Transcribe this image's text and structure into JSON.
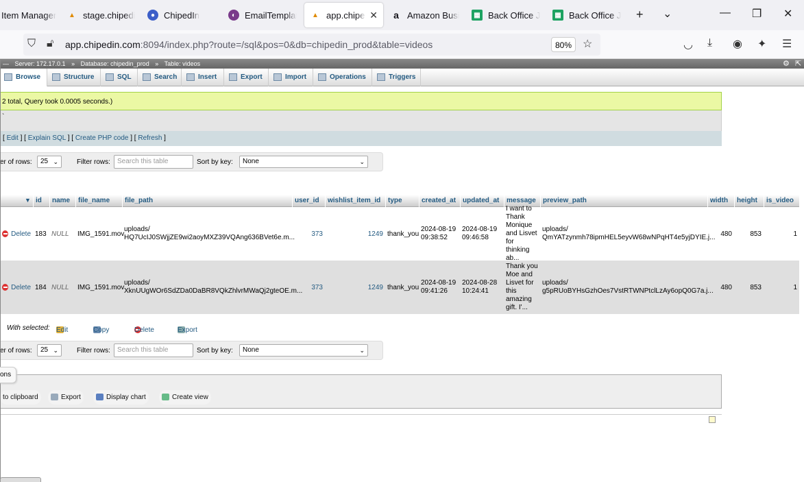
{
  "browser": {
    "tabs": [
      {
        "title": "Item Manager",
        "icon": "page-icon"
      },
      {
        "title": "stage.chipedin",
        "icon": "pma-icon"
      },
      {
        "title": "ChipedIn",
        "icon": "chipedin-icon"
      },
      {
        "title": "EmailTemplate",
        "icon": "email-icon"
      },
      {
        "title": "app.chipedi",
        "icon": "pma-icon",
        "active": true
      },
      {
        "title": "Amazon Busine",
        "icon": "amazon-icon"
      },
      {
        "title": "Back Office Ju",
        "icon": "sheets-icon"
      },
      {
        "title": "Back Office Ju",
        "icon": "sheets-icon"
      }
    ],
    "url_host": "app.chipedin.com",
    "url_rest": ":8094/index.php?route=/sql&pos=0&db=chipedin_prod&table=videos",
    "zoom": "80%",
    "new_tab": "+",
    "list_tabs": "⌄",
    "minimize": "—",
    "maximize": "❐",
    "close": "✕"
  },
  "pma": {
    "breadcrumb": {
      "server": "Server: 172.17.0.1",
      "database": "Database: chipedin_prod",
      "table": "Table: videos"
    },
    "tabs": [
      "Browse",
      "Structure",
      "SQL",
      "Search",
      "Insert",
      "Export",
      "Import",
      "Operations",
      "Triggers"
    ],
    "success_msg": "2 total, Query took 0.0005 seconds.)",
    "sql_text": "`",
    "sql_links": {
      "edit": "Edit",
      "explain": "Explain SQL",
      "php": "Create PHP code",
      "refresh": "Refresh"
    },
    "nav": {
      "rows_label": "er of rows:",
      "rows_value": "25",
      "filter_label": "Filter rows:",
      "filter_placeholder": "Search this table",
      "sort_label": "Sort by key:",
      "sort_value": "None"
    },
    "columns": [
      "id",
      "name",
      "file_name",
      "file_path",
      "user_id",
      "wishlist_item_id",
      "type",
      "created_at",
      "updated_at",
      "message",
      "preview_path",
      "width",
      "height",
      "is_video"
    ],
    "rows": [
      {
        "delete": "Delete",
        "id": "183",
        "name": "NULL",
        "file_name": "IMG_1591.mov",
        "file_path_1": "uploads/",
        "file_path_2": "HQ7UcIJ0SWjjZE9wi2aoyMXZ39VQAng636BVet6e.m...",
        "user_id": "373",
        "wishlist_item_id": "1249",
        "type": "thank_you",
        "created_1": "2024-08-19",
        "created_2": "09:38:52",
        "updated_1": "2024-08-19",
        "updated_2": "09:46:58",
        "message": [
          "I want to",
          "Thank",
          "Monique",
          "and Lisvet",
          "for thinking",
          "ab..."
        ],
        "preview_1": "uploads/",
        "preview_2": "QmYATzynmh78ipmHEL5eyvW68wNPqHT4e5yjDYIE.j...",
        "width": "480",
        "height": "853",
        "is_video": "1"
      },
      {
        "delete": "Delete",
        "id": "184",
        "name": "NULL",
        "file_name": "IMG_1591.mov",
        "file_path_1": "uploads/",
        "file_path_2": "XknUUgWOr6SdZDa0DaBR8VQkZhlvrMWaQj2gteOE.m...",
        "user_id": "373",
        "wishlist_item_id": "1249",
        "type": "thank_you",
        "created_1": "2024-08-19",
        "created_2": "09:41:26",
        "updated_1": "2024-08-28",
        "updated_2": "10:24:41",
        "message": [
          "Thank you",
          "Moe and",
          "Lisvet for",
          "this",
          "amazing",
          "gift. I'..."
        ],
        "preview_1": "uploads/",
        "preview_2": "g5pRUoBYHsGzhOes7VstRTWNPtclLzAy6opQ0G7a.j...",
        "width": "480",
        "height": "853",
        "is_video": "1"
      }
    ],
    "with_selected": {
      "label": "With selected:",
      "edit": "Edit",
      "copy": "Copy",
      "delete": "Delete",
      "export": "Export"
    },
    "ops": {
      "head": "ons",
      "clipboard": "to clipboard",
      "export": "Export",
      "chart": "Display chart",
      "view": "Create view"
    }
  }
}
